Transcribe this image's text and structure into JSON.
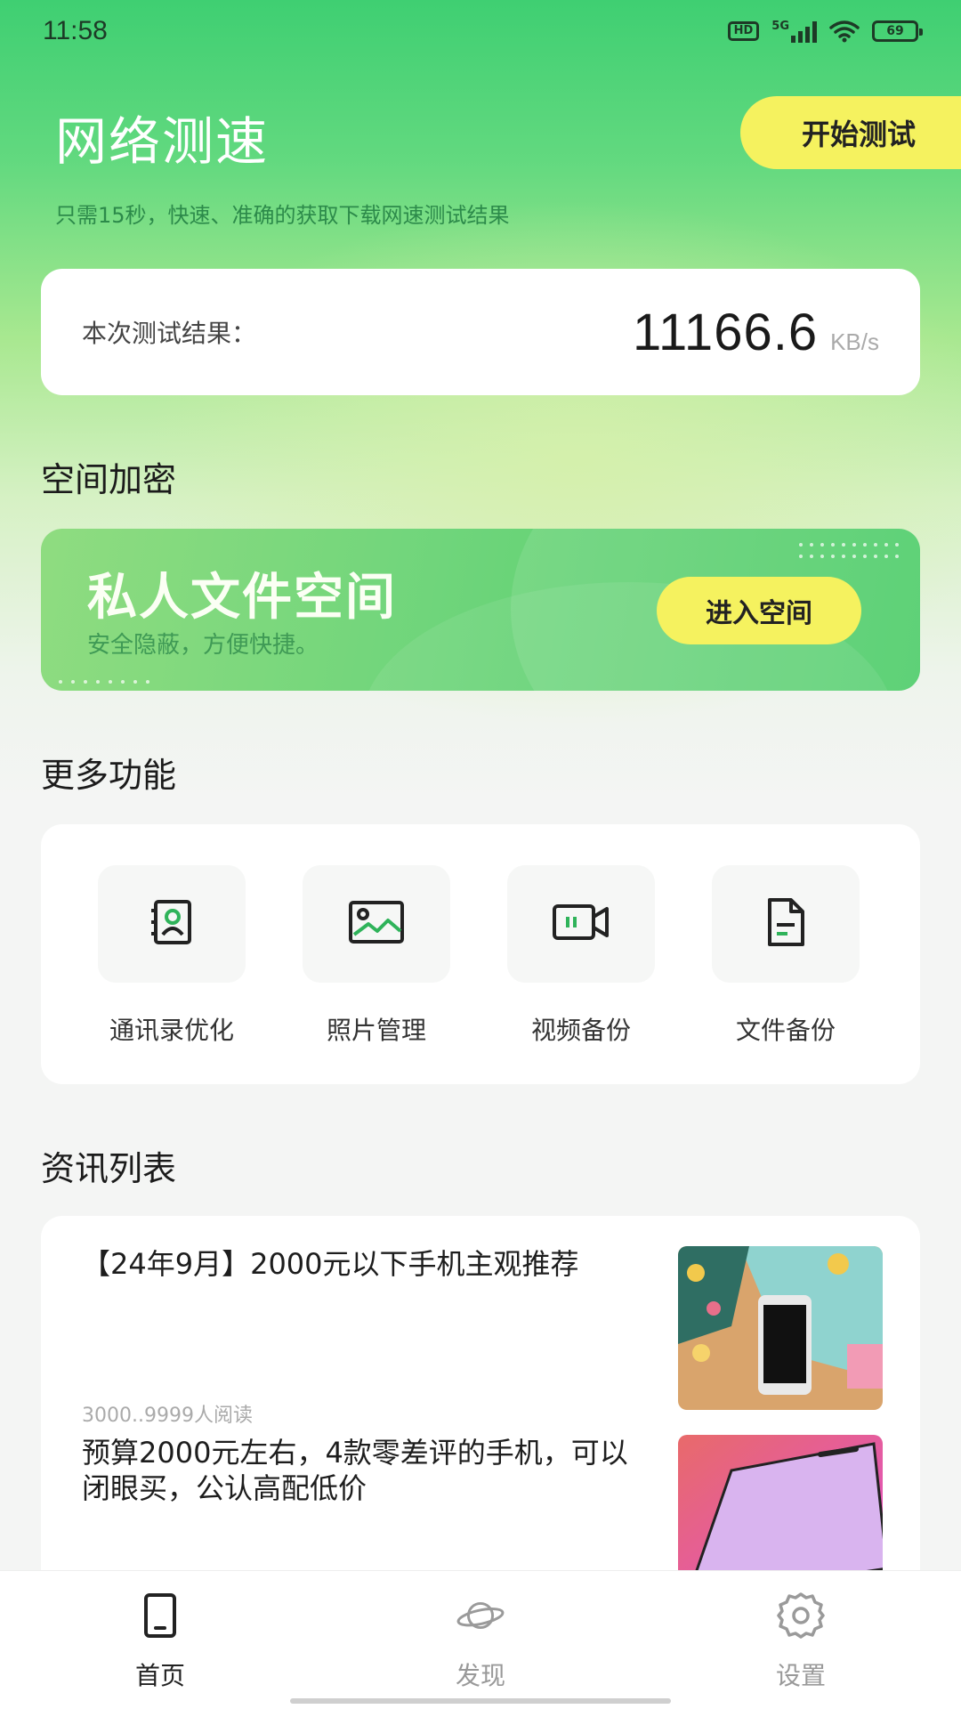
{
  "status_bar": {
    "time": "11:58",
    "hd_badge": "HD",
    "network_label": "5G",
    "battery_text": "69"
  },
  "header": {
    "title": "网络测速",
    "start_button": "开始测试",
    "subtitle": "只需15秒，快速、准确的获取下载网速测试结果"
  },
  "result": {
    "label": "本次测试结果：",
    "value": "11166.6",
    "unit": "KB/s"
  },
  "space_section": {
    "title": "空间加密",
    "banner_title": "私人文件空间",
    "banner_subtitle": "安全隐蔽，方便快捷。",
    "enter_button": "进入空间"
  },
  "functions_section": {
    "title": "更多功能",
    "items": [
      {
        "label": "通讯录优化",
        "icon": "contacts-icon"
      },
      {
        "label": "照片管理",
        "icon": "photo-icon"
      },
      {
        "label": "视频备份",
        "icon": "video-icon"
      },
      {
        "label": "文件备份",
        "icon": "file-icon"
      }
    ]
  },
  "news_section": {
    "title": "资讯列表",
    "items": [
      {
        "title": "【24年9月】2000元以下手机主观推荐",
        "meta": "3000..9999人阅读"
      },
      {
        "title": "预算2000元左右，4款零差评的手机，可以闭眼买，公认高配低价",
        "meta": ""
      }
    ]
  },
  "tabbar": {
    "tabs": [
      {
        "label": "首页",
        "icon": "phone-icon",
        "active": true
      },
      {
        "label": "发现",
        "icon": "planet-icon",
        "active": false
      },
      {
        "label": "设置",
        "icon": "gear-icon",
        "active": false
      }
    ]
  },
  "colors": {
    "accent_green": "#3fcf72",
    "button_yellow": "#f5f25f",
    "icon_green": "#2fb35a"
  }
}
